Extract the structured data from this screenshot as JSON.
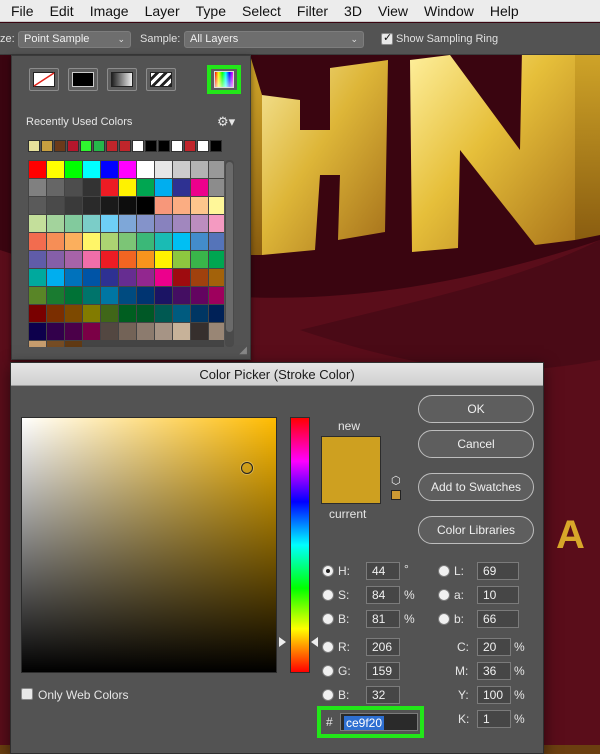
{
  "menubar": {
    "items": [
      "File",
      "Edit",
      "Image",
      "Layer",
      "Type",
      "Select",
      "Filter",
      "3D",
      "View",
      "Window",
      "Help"
    ]
  },
  "options_bar": {
    "size_label": "ze:",
    "size_value": "Point Sample",
    "sample_label": "Sample:",
    "sample_value": "All Layers",
    "show_ring_label": "Show Sampling Ring",
    "show_ring_checked": true
  },
  "swatches_panel": {
    "recent_label": "Recently Used Colors",
    "recent_colors": [
      "#e8e29c",
      "#c8a040",
      "#6a3a1a",
      "#b5162c",
      "#2ff52f",
      "#25b84a",
      "#c0252b",
      "#c0252b",
      "#ffffff",
      "#000000",
      "#000000",
      "#ffffff",
      "#c0252b",
      "#ffffff",
      "#000000"
    ],
    "grid_colors": [
      "#ff0000",
      "#ffff00",
      "#00ff00",
      "#00ffff",
      "#0000ff",
      "#ff00ff",
      "#ffffff",
      "#e6e6e6",
      "#cccccc",
      "#b3b3b3",
      "#999999",
      "#808080",
      "#666666",
      "#4d4d4d",
      "#333333",
      "#ed1c24",
      "#fff200",
      "#00a651",
      "#00aeef",
      "#2e3192",
      "#ec008c",
      "#8c8c8c",
      "#5a5a5a",
      "#4a4a4a",
      "#3a3a3a",
      "#2a2a2a",
      "#1a1a1a",
      "#0d0d0d",
      "#000000",
      "#f7977a",
      "#fbad82",
      "#fdc68c",
      "#fff799",
      "#c4df9b",
      "#a3d39c",
      "#82ca9d",
      "#7bcdc8",
      "#6ecff6",
      "#7ea7d8",
      "#8493ca",
      "#8882be",
      "#a187be",
      "#bc8dbf",
      "#f49ac1",
      "#f26c4f",
      "#f68e56",
      "#fbaf5d",
      "#fff568",
      "#acd372",
      "#7cc576",
      "#3bb878",
      "#1abbb4",
      "#00bff3",
      "#438ccb",
      "#5574b9",
      "#605ca8",
      "#855fa8",
      "#a763a8",
      "#f06ea9",
      "#ed1c24",
      "#f26522",
      "#f7941d",
      "#fff200",
      "#8dc73f",
      "#39b54a",
      "#00a651",
      "#00a99d",
      "#00aeef",
      "#0072bc",
      "#0054a6",
      "#2e3192",
      "#662d91",
      "#92278f",
      "#ec008c",
      "#9e0b0f",
      "#a0410d",
      "#a3620a",
      "#598527",
      "#1a7b30",
      "#007236",
      "#00746b",
      "#0076a3",
      "#004b80",
      "#003471",
      "#1b1464",
      "#440e62",
      "#630460",
      "#9e005d",
      "#790000",
      "#7b2e00",
      "#7d4900",
      "#827b00",
      "#406618",
      "#005e20",
      "#005826",
      "#005952",
      "#005b7f",
      "#003663",
      "#002157",
      "#0d004c",
      "#32004b",
      "#4b0049",
      "#7b0046",
      "#534741",
      "#736357",
      "#8c7b6e",
      "#a69485",
      "#c7b299",
      "#362f2d",
      "#998675",
      "#c69c6d",
      "#754c24",
      "#603913"
    ],
    "icons": {
      "gear": "gear-icon",
      "picker": "color-picker-icon"
    }
  },
  "color_picker": {
    "title": "Color Picker (Stroke Color)",
    "new_label": "new",
    "current_label": "current",
    "new_color": "#cea020",
    "current_color": "#cea020",
    "buttons": {
      "ok": "OK",
      "cancel": "Cancel",
      "add_to_swatches": "Add to Swatches",
      "color_libraries": "Color Libraries"
    },
    "fields": {
      "H": {
        "label": "H:",
        "value": "44",
        "unit": "°",
        "selected": true
      },
      "S": {
        "label": "S:",
        "value": "84",
        "unit": "%"
      },
      "Bv": {
        "label": "B:",
        "value": "81",
        "unit": "%"
      },
      "R": {
        "label": "R:",
        "value": "206"
      },
      "G": {
        "label": "G:",
        "value": "159"
      },
      "Bc": {
        "label": "B:",
        "value": "32"
      },
      "L": {
        "label": "L:",
        "value": "69"
      },
      "a": {
        "label": "a:",
        "value": "10"
      },
      "b": {
        "label": "b:",
        "value": "66"
      },
      "C": {
        "label": "C:",
        "value": "20",
        "unit": "%"
      },
      "M": {
        "label": "M:",
        "value": "36",
        "unit": "%"
      },
      "Y": {
        "label": "Y:",
        "value": "100",
        "unit": "%"
      },
      "K": {
        "label": "K:",
        "value": "1",
        "unit": "%"
      }
    },
    "hex_label": "#",
    "hex_value": "ce9f20",
    "web_only_label": "Only Web Colors",
    "web_only_checked": false
  },
  "artwork_text": "A"
}
